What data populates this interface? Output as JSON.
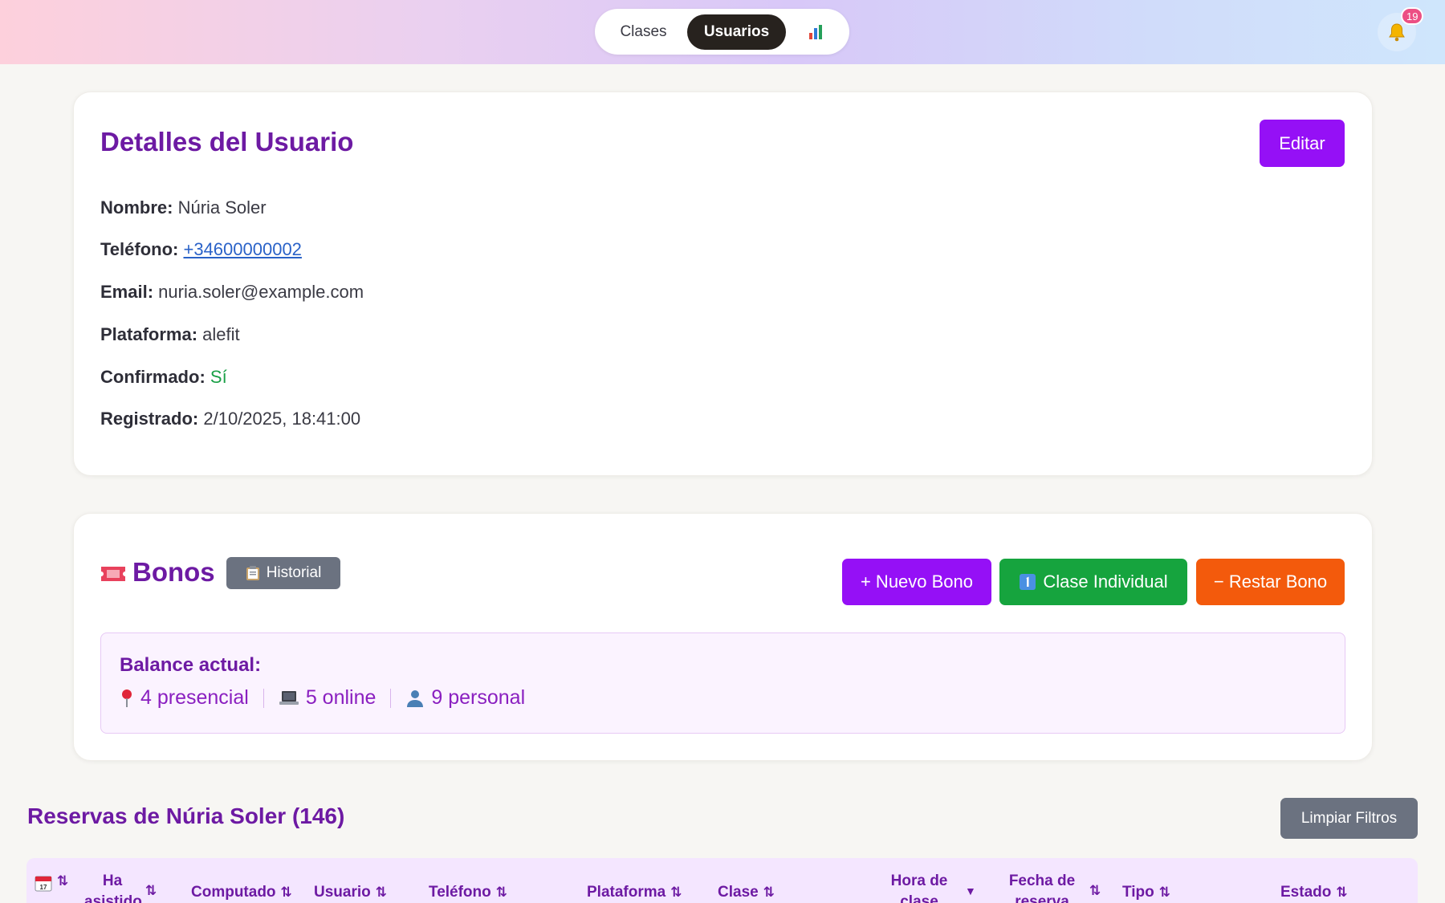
{
  "nav": {
    "tabs": [
      {
        "label": "Clases"
      },
      {
        "label": "Usuarios"
      }
    ],
    "stats_icon": "bar-chart-icon",
    "notifications_count": "19"
  },
  "details": {
    "title": "Detalles del Usuario",
    "edit_label": "Editar",
    "fields": [
      {
        "label": "Nombre:",
        "value": "Núria Soler"
      },
      {
        "label": "Teléfono:",
        "value": "+34600000002"
      },
      {
        "label": "Email:",
        "value": "nuria.soler@example.com"
      },
      {
        "label": "Plataforma:",
        "value": "alefit"
      },
      {
        "label": "Confirmado:",
        "value": "Sí"
      },
      {
        "label": "Registrado:",
        "value": "2/10/2025, 18:41:00"
      }
    ]
  },
  "bonos": {
    "title": "Bonos",
    "historial_label": "Historial",
    "new_label": "+ Nuevo Bono",
    "individual_label": "Clase Individual",
    "restar_label": "− Restar Bono",
    "balance_title": "Balance actual:",
    "balance": [
      {
        "icon": "pin-icon",
        "text": "4 presencial"
      },
      {
        "icon": "laptop-icon",
        "text": "5 online"
      },
      {
        "icon": "person-icon",
        "text": "9 personal"
      }
    ]
  },
  "reservas": {
    "title": "Reservas de Núria Soler (146)",
    "clear_label": "Limpiar Filtros",
    "columns": [
      {
        "label": ""
      },
      {
        "label": "Ha asistido"
      },
      {
        "label": "Computado"
      },
      {
        "label": "Usuario"
      },
      {
        "label": "Teléfono"
      },
      {
        "label": "Plataforma"
      },
      {
        "label": "Clase"
      },
      {
        "label": "Hora de clase"
      },
      {
        "label": "Fecha de reserva"
      },
      {
        "label": "Tipo"
      },
      {
        "label": "Estado"
      }
    ]
  },
  "colors": {
    "accent": "#9510f6",
    "title": "#6d1aa3",
    "green": "#16a43e",
    "orange": "#f35a0c",
    "gray": "#6b7280"
  }
}
